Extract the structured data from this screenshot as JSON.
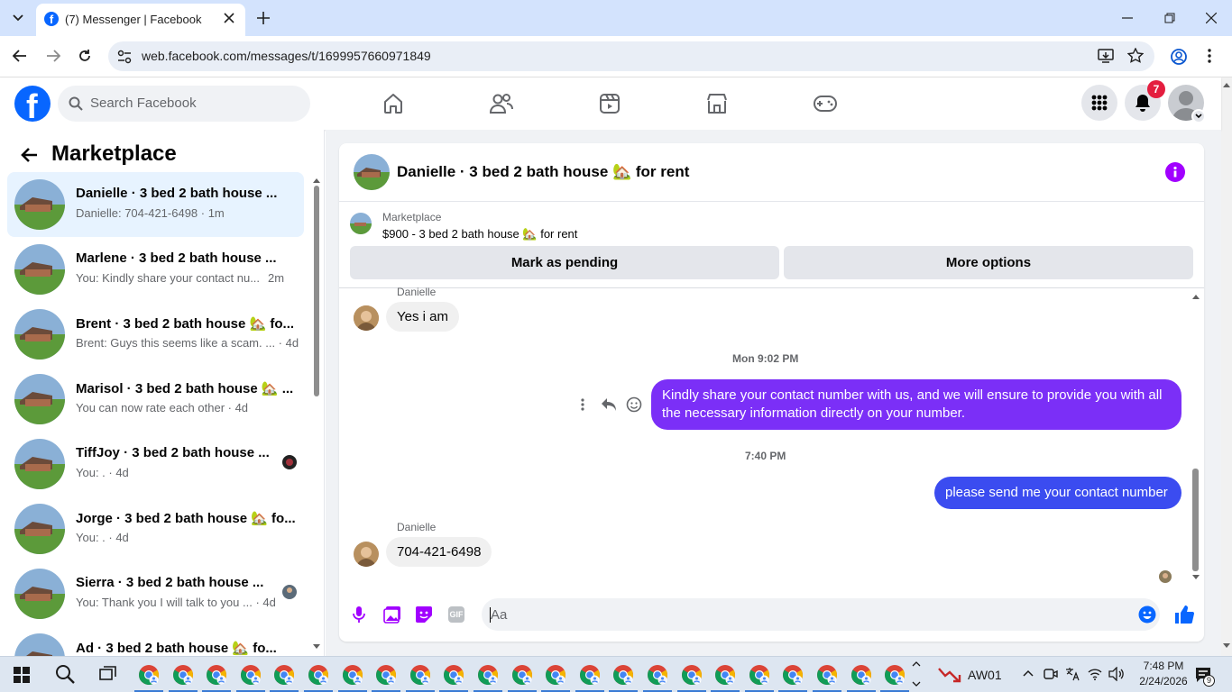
{
  "browser": {
    "tab_title": "(7) Messenger | Facebook",
    "url": "web.facebook.com/messages/t/1699957660971849"
  },
  "header": {
    "search_placeholder": "Search Facebook",
    "notification_count": "7",
    "nav_icons": [
      "home-icon",
      "friends-icon",
      "video-icon",
      "marketplace-icon",
      "gaming-icon"
    ]
  },
  "sidebar": {
    "title": "Marketplace",
    "conversations": [
      {
        "name": "Danielle · 3 bed 2 bath house ...",
        "preview": "Danielle: 704-421-6498 · 1m",
        "selected": true
      },
      {
        "name": "Marlene · 3 bed 2 bath house ...",
        "preview": "You: Kindly share your contact nu...",
        "time": "2m"
      },
      {
        "name": "Brent · 3 bed 2 bath house 🏡 fo...",
        "preview": "Brent: Guys this seems like a scam. ... · 4d"
      },
      {
        "name": "Marisol · 3 bed 2 bath house 🏡 ...",
        "preview": "You can now rate each other · 4d"
      },
      {
        "name": "TiffJoy · 3 bed 2 bath house ...",
        "preview": "You: . · 4d"
      },
      {
        "name": "Jorge · 3 bed 2 bath house 🏡 fo...",
        "preview": "You: . · 4d"
      },
      {
        "name": "Sierra · 3 bed 2 bath house ...",
        "preview": "You: Thank you I will talk to you ... · 4d"
      },
      {
        "name": "Ad · 3 bed 2 bath house 🏡 fo...",
        "preview": ""
      }
    ]
  },
  "chat": {
    "title": "Danielle · 3 bed 2 bath house 🏡 for rent",
    "listing": {
      "label": "Marketplace",
      "title": "$900 - 3 bed 2 bath house 🏡 for rent"
    },
    "mark_pending": "Mark as pending",
    "more_options": "More options",
    "messages": {
      "sender_top": "Danielle",
      "msg1": "Yes i am",
      "stamp1": "Mon 9:02 PM",
      "msg2": "Kindly share your contact number with us, and we will ensure to provide you with all the necessary information directly on your number.",
      "stamp2": "7:40 PM",
      "msg3": "please send me  your contact number",
      "sender_bottom": "Danielle",
      "msg4": "704-421-6498"
    },
    "composer_placeholder": "Aa",
    "accent": "#7b2ff7"
  },
  "taskbar": {
    "app_label": "AW01",
    "time": "7:48 PM",
    "date": "2/24/2026",
    "notif_count": "9"
  }
}
